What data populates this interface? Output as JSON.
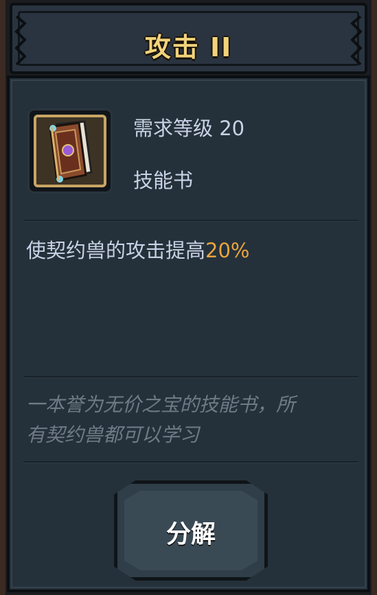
{
  "title": "攻击 II",
  "item": {
    "icon": "skill-book-icon",
    "required_level": "需求等级 20",
    "type": "技能书"
  },
  "effect": {
    "text": "使契约兽的攻击提高",
    "value": "20%"
  },
  "lore": {
    "line1": "一本誉为无价之宝的技能书，所",
    "line2": "有契约兽都可以学习"
  },
  "button": {
    "decompose_label": "分解"
  },
  "colors": {
    "title": "#f1d37b",
    "highlight": "#e9a43e",
    "text": "#c9d2e6",
    "lore": "#6f7a86",
    "panel": "#25313a"
  }
}
